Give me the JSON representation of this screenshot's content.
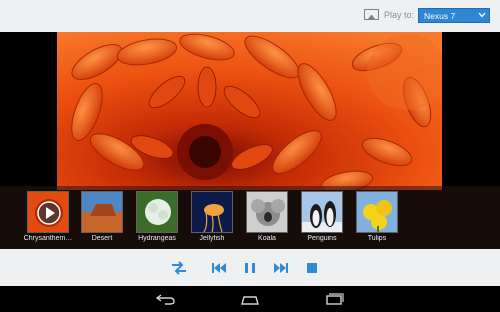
{
  "header": {
    "play_to_label": "Play to:",
    "device_selected": "Nexus 7",
    "icons": [
      "cast-screen-icon",
      "chevron-down-icon"
    ]
  },
  "viewer": {
    "current_photo": "Chrysanthemum"
  },
  "thumbnails": [
    {
      "label": "Chrysanthem…",
      "playing": true
    },
    {
      "label": "Desert"
    },
    {
      "label": "Hydrangeas"
    },
    {
      "label": "Jellyfish"
    },
    {
      "label": "Koala"
    },
    {
      "label": "Penguins"
    },
    {
      "label": "Tulips"
    }
  ],
  "controls": [
    "shuffle-icon",
    "previous-icon",
    "pause-icon",
    "next-icon",
    "stop-icon"
  ],
  "navigation": [
    "back-icon",
    "home-icon",
    "recent-apps-icon"
  ],
  "colors": {
    "accent": "#2e86d4",
    "control_icon": "#2f8ad8",
    "bar_background": "#eef0f2"
  }
}
